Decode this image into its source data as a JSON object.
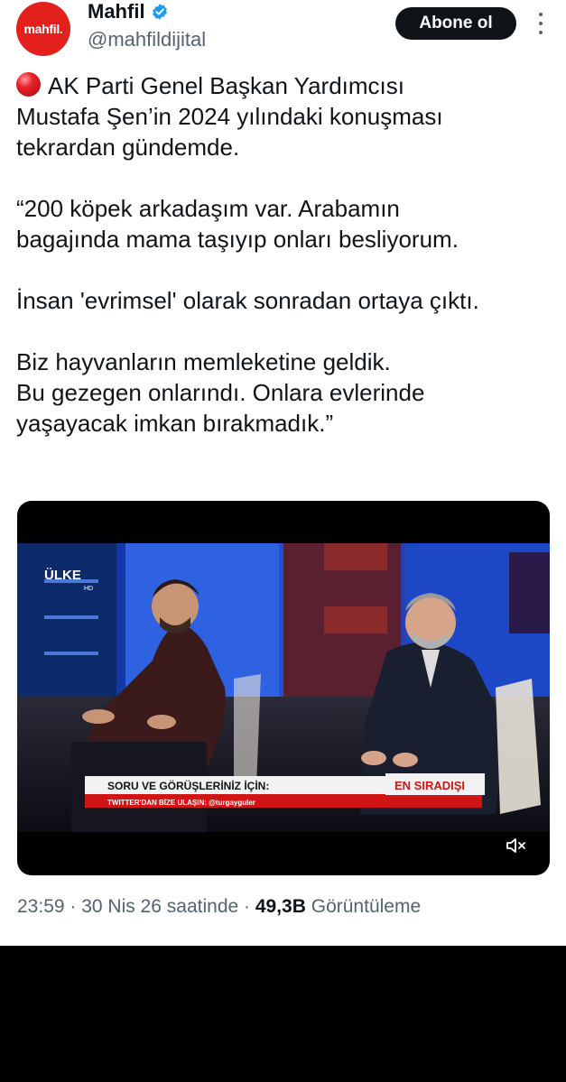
{
  "account": {
    "avatar_text": "mahfil.",
    "display_name": "Mahfil",
    "handle": "@mahfildijital",
    "follow_label": "Abone ol"
  },
  "tweet": {
    "lines": [
      "AK Parti Genel Başkan Yardımcısı",
      "Mustafa Şen’in 2024 yılındaki konuşması",
      "tekrardan gündemde.",
      "“200 köpek arkadaşım var. Arabamın",
      "bagajında mama taşıyıp onları besliyorum.",
      "İnsan 'evrimsel' olarak sonradan ortaya çıktı.",
      "Biz hayvanların memleketine geldik.",
      "Bu gezegen onlarındı. Onlara evlerinde",
      "yaşayacak imkan bırakmadık.”"
    ]
  },
  "video": {
    "channel_logo": "ÜLKE",
    "channel_logo_sub": "HD",
    "lower_third_title": "SORU VE GÖRÜŞLERİNİZ İÇİN:",
    "lower_third_sub": "TWITTER'DAN BİZE ULAŞIN: @turgayguler",
    "program_tag": "EN SIRADIŞI",
    "mute_icon": "speaker-muted-icon"
  },
  "meta": {
    "time": "23:59",
    "sep1": " · ",
    "date": "30 Nis 26 saatinde",
    "sep2": " · ",
    "views": "49,3B",
    "views_label": " Görüntüleme"
  },
  "colors": {
    "brand_red": "#e3201b",
    "verified_blue": "#1d9bf0",
    "secondary_text": "#536471"
  }
}
